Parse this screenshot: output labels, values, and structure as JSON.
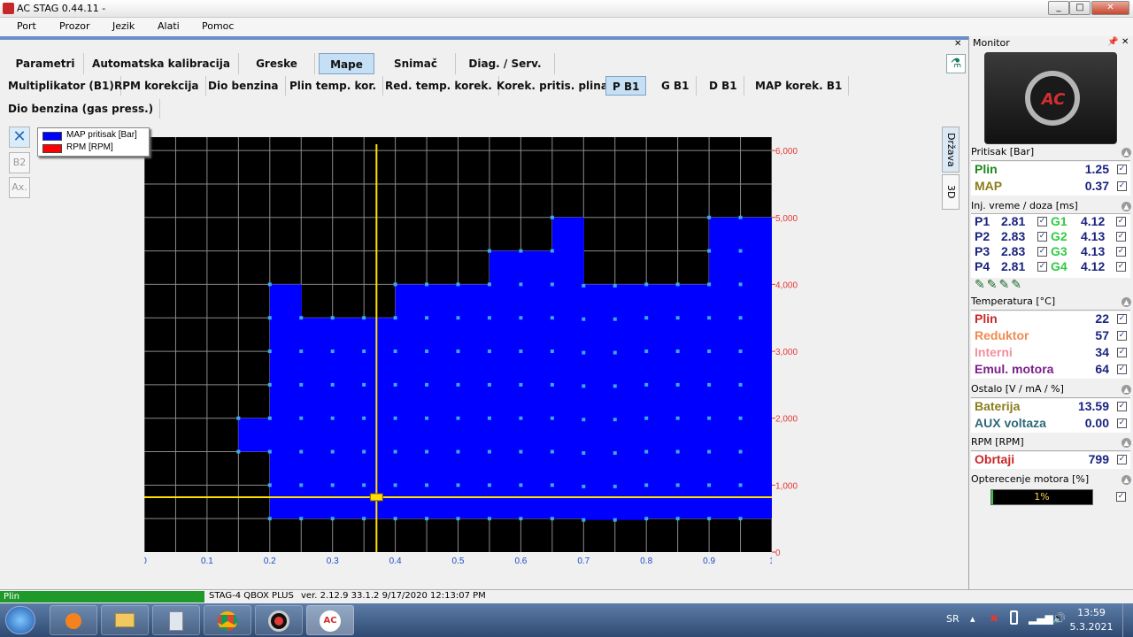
{
  "window": {
    "title": "AC STAG 0.44.11 -",
    "min": "_",
    "max": "□",
    "close": "✕"
  },
  "menu": [
    "Port",
    "Prozor",
    "Jezik",
    "Alati",
    "Pomoc"
  ],
  "tabs_main": [
    {
      "label": "Parametri"
    },
    {
      "label": "Automatska kalibracija"
    },
    {
      "label": "Greske"
    },
    {
      "label": "Mape",
      "active": true
    },
    {
      "label": "Snimač"
    },
    {
      "label": "Diag. / Serv."
    }
  ],
  "tabs_maps": [
    {
      "label": "Multiplikator (B1)"
    },
    {
      "label": "RPM korekcija"
    },
    {
      "label": "Dio benzina"
    },
    {
      "label": "Plin temp. kor."
    },
    {
      "label": "Red. temp. korek."
    },
    {
      "label": "Korek. pritis. plina"
    },
    {
      "label": "P B1",
      "active": true
    },
    {
      "label": "G B1"
    },
    {
      "label": "D B1"
    },
    {
      "label": "MAP korek. B1"
    }
  ],
  "tabs_maps_row2": [
    {
      "label": "Dio benzina (gas press.)"
    }
  ],
  "side_buttons": {
    "b2": "B2",
    "ax": "Ax."
  },
  "vertical_tabs": {
    "drzava": "Država",
    "three_d": "3D"
  },
  "legend": {
    "items": [
      {
        "label": "MAP pritisak [Bar]",
        "color": "#0000ff"
      },
      {
        "label": "RPM [RPM]",
        "color": "#ff0000"
      }
    ]
  },
  "chart_data": {
    "type": "area",
    "x_ticks": [
      "0",
      "0.1",
      "0.2",
      "0.3",
      "0.4",
      "0.5",
      "0.6",
      "0.7",
      "0.8",
      "0.9",
      "1"
    ],
    "y_ticks_right": [
      "0",
      "1,000",
      "2,000",
      "3,000",
      "4,000",
      "5,000",
      "6,000"
    ],
    "xlim": [
      0,
      1
    ],
    "ylim": [
      0,
      6200
    ],
    "series": [
      {
        "name": "MAP pritisak [Bar]",
        "color": "#0000ff",
        "x": [
          0.15,
          0.2,
          0.25,
          0.3,
          0.35,
          0.4,
          0.45,
          0.5,
          0.55,
          0.6,
          0.65,
          0.7,
          0.75,
          0.8,
          0.85,
          0.9,
          0.95
        ],
        "top": [
          2000,
          4000,
          3500,
          3500,
          3500,
          4000,
          4000,
          4000,
          4500,
          4500,
          5000,
          4000,
          4000,
          4000,
          4000,
          5000,
          5000
        ],
        "bottom": [
          2000,
          500,
          500,
          500,
          500,
          500,
          500,
          500,
          500,
          500,
          500,
          480,
          480,
          500,
          500,
          500,
          500
        ]
      }
    ],
    "cursor": {
      "x": 0.37,
      "y": 820
    },
    "grid": true
  },
  "monitor": {
    "title": "Monitor",
    "pin": "ᵖ",
    "close": "✕",
    "pritisak": {
      "header": "Pritisak [Bar]",
      "rows": [
        {
          "label": "Plin",
          "value": "1.25",
          "color": "#1b8a1b"
        },
        {
          "label": "MAP",
          "value": "0.37",
          "color": "#8b7d1b"
        }
      ]
    },
    "inj": {
      "header": "Inj. vreme / doza [ms]",
      "rows": [
        {
          "p": "P1",
          "pv": "2.81",
          "g": "G1",
          "gv": "4.12"
        },
        {
          "p": "P2",
          "pv": "2.83",
          "g": "G2",
          "gv": "4.13"
        },
        {
          "p": "P3",
          "pv": "2.83",
          "g": "G3",
          "gv": "4.13"
        },
        {
          "p": "P4",
          "pv": "2.81",
          "g": "G4",
          "gv": "4.12"
        }
      ]
    },
    "temperatura": {
      "header": "Temperatura [°C]",
      "rows": [
        {
          "label": "Plin",
          "value": "22",
          "color": "#c62828"
        },
        {
          "label": "Reduktor",
          "value": "57",
          "color": "#f08a50"
        },
        {
          "label": "Interni",
          "value": "34",
          "color": "#f28fa0"
        },
        {
          "label": "Emul. motora",
          "value": "64",
          "color": "#7b1f8a"
        }
      ]
    },
    "ostalo": {
      "header": "Ostalo [V / mA / %]",
      "rows": [
        {
          "label": "Baterija",
          "value": "13.59",
          "color": "#8b7d1b"
        },
        {
          "label": "AUX voltaza",
          "value": "0.00",
          "color": "#2d6a78"
        }
      ]
    },
    "rpm": {
      "header": "RPM [RPM]",
      "rows": [
        {
          "label": "Obrtaji",
          "value": "799",
          "color": "#c62828"
        }
      ]
    },
    "opterecenje": {
      "header": "Opterecenje motora [%]",
      "value": "1%"
    }
  },
  "status": {
    "mode": "Plin",
    "device": "STAG-4 QBOX PLUS",
    "version": "ver. 2.12.9  33.1.2  9/17/2020 12:13:07 PM"
  },
  "taskbar": {
    "lang": "SR",
    "time": "13:59",
    "date": "5.3.2021"
  }
}
